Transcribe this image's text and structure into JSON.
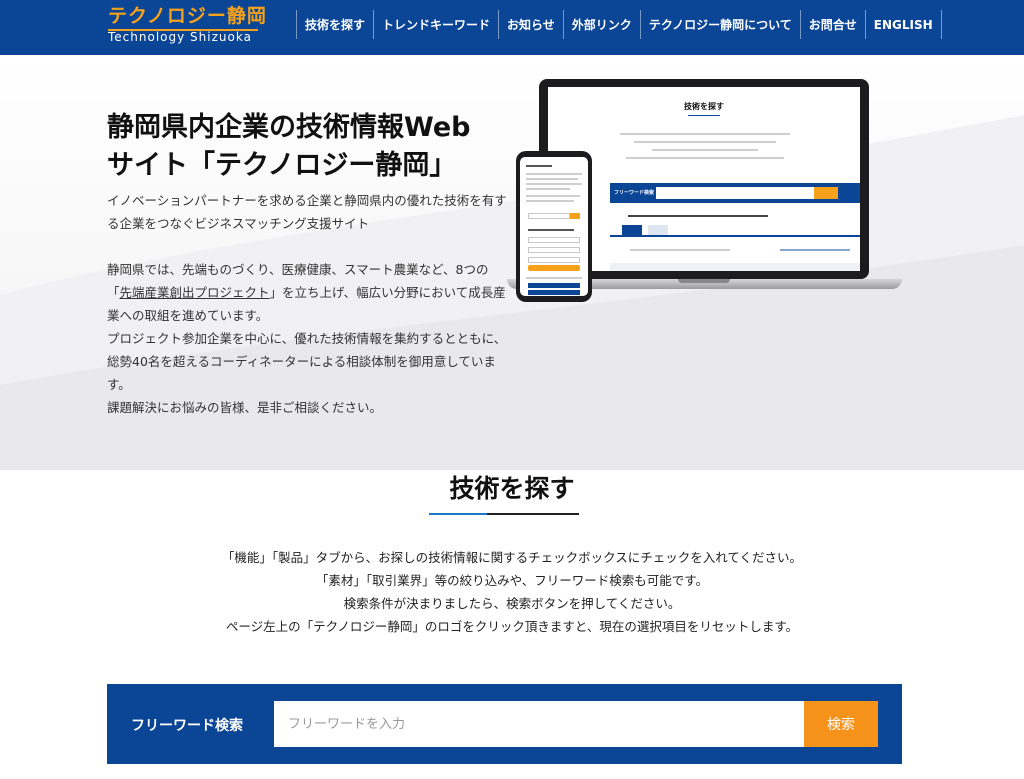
{
  "colors": {
    "brand_blue": "#0a4596",
    "accent_orange": "#f5a21a",
    "button_orange": "#f5921a",
    "underline_blue": "#1c78c8"
  },
  "header": {
    "logo_jp": "テクノロジー静岡",
    "logo_en": "Technology Shizuoka",
    "nav": [
      {
        "label": "技術を探す"
      },
      {
        "label": "トレンドキーワード"
      },
      {
        "label": "お知らせ"
      },
      {
        "label": "外部リンク"
      },
      {
        "label": "テクノロジー静岡について"
      },
      {
        "label": "お問合せ"
      },
      {
        "label": "ENGLISH"
      }
    ]
  },
  "hero": {
    "title_line1": "静岡県内企業の技術情報Web",
    "title_line2": "サイト「テクノロジー静岡」",
    "lead": "イノベーションパートナーを求める企業と静岡県内の優れた技術を有する企業をつなぐビジネスマッチング支援サイト",
    "body_1_before": "静岡県では、先端ものづくり、医療健康、スマート農業など、8つの「",
    "body_1_link": "先端産業創出プロジェクト",
    "body_1_after": "」を立ち上げ、幅広い分野において成長産業への取組を進めています。",
    "body_2": "プロジェクト参加企業を中心に、優れた技術情報を集約するとともに、総勢40名を超えるコーディネーターによる相談体制を御用意しています。",
    "body_3": "課題解決にお悩みの皆様、是非ご相談ください。"
  },
  "search_section": {
    "title": "技術を探す",
    "desc": [
      "「機能」「製品」タブから、お探しの技術情報に関するチェックボックスにチェックを入れてください。",
      "「素材」「取引業界」等の絞り込みや、フリーワード検索も可能です。",
      "検索条件が決まりましたら、検索ボタンを押してください。",
      "ページ左上の「テクノロジー静岡」のロゴをクリック頂きますと、現在の選択項目をリセットします。"
    ],
    "freeword_label": "フリーワード検索",
    "freeword_placeholder": "フリーワードを入力",
    "freeword_value": "",
    "search_button": "検索"
  }
}
